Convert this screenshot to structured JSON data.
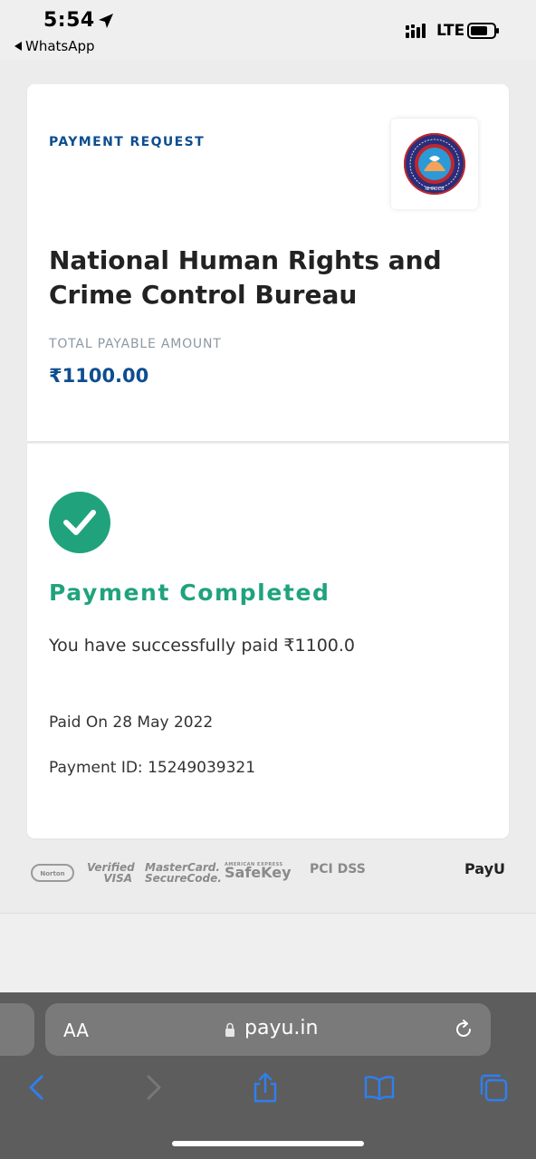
{
  "status_bar": {
    "time": "5:54",
    "back_app": "WhatsApp",
    "network": "LTE"
  },
  "payment_card": {
    "request_label": "PAYMENT REQUEST",
    "merchant_name": "National Human Rights and Crime Control Bureau",
    "total_label": "TOTAL PAYABLE AMOUNT",
    "amount": "₹1100.00",
    "logo_caption": "NHRCCB"
  },
  "result": {
    "status_title": "Payment Completed",
    "message": "You have successfully paid ₹1100.0",
    "paid_on": "Paid On 28 May 2022",
    "payment_id": "Payment ID: 15249039321"
  },
  "trust_badges": {
    "norton": "Norton",
    "verified_visa_line1": "Verified",
    "verified_visa_line2": "VISA",
    "mastercard_line1": "MasterCard.",
    "mastercard_line2": "SecureCode.",
    "amex_small": "AMERICAN EXPRESS",
    "safekey": "SafeKey",
    "pci": "PCI DSS",
    "payu": "PayU"
  },
  "browser": {
    "text_size_label": "AA",
    "url": "payu.in"
  },
  "colors": {
    "brand_blue": "#0d4e8f",
    "success_green": "#20a37d",
    "safari_bar": "#5d5d5d",
    "ios_blue": "#2f7ff0"
  }
}
